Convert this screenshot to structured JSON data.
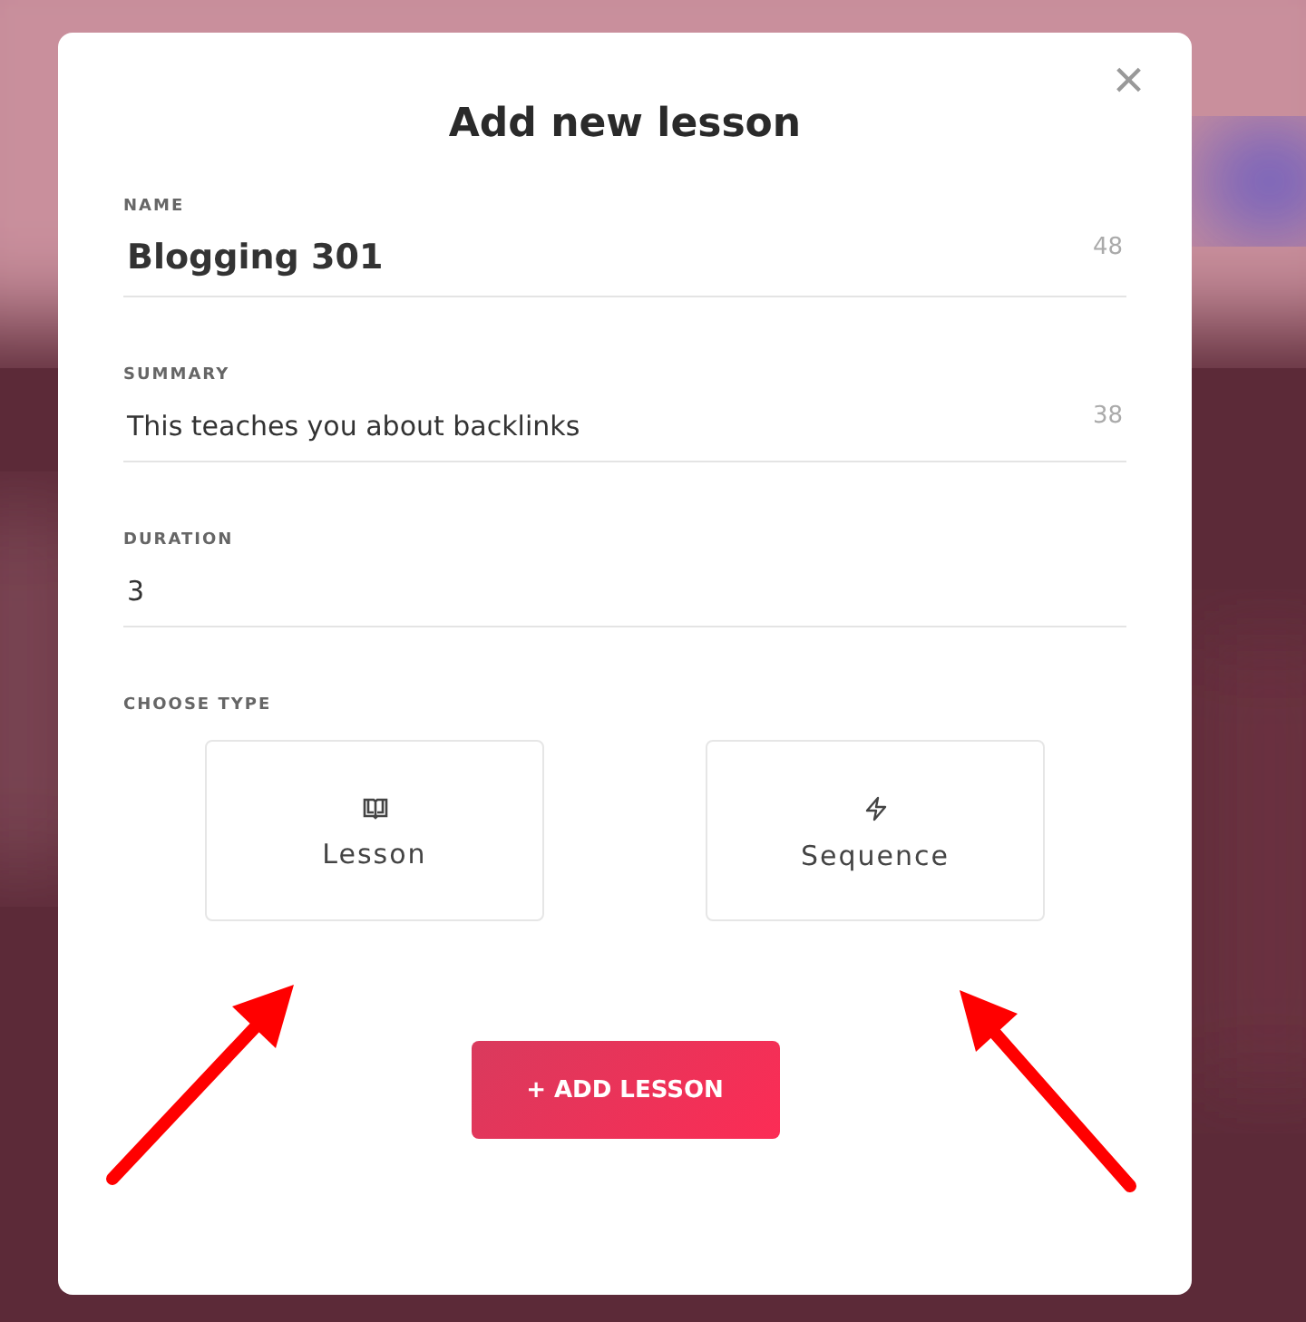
{
  "dialog": {
    "title": "Add new lesson",
    "close": "×",
    "fields": [
      {
        "label": "NAME",
        "value": "Blogging 301",
        "counter": "48",
        "kind": "title"
      },
      {
        "label": "SUMMARY",
        "value": "This teaches you about backlinks",
        "counter": "38",
        "kind": "text"
      },
      {
        "label": "DURATION",
        "value": "3",
        "kind": "text"
      }
    ],
    "type_label": "CHOOSE TYPE",
    "types": [
      {
        "label": "Lesson",
        "kind": "book"
      },
      {
        "label": "Sequence",
        "kind": "bolt"
      }
    ],
    "submit": "+ ADD LESSON"
  }
}
